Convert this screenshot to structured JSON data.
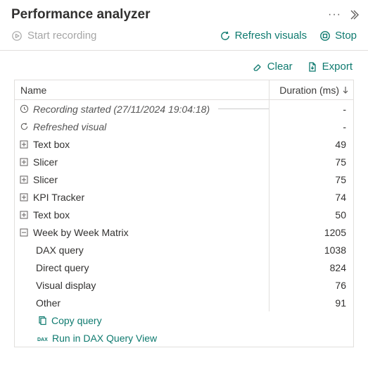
{
  "header": {
    "title": "Performance analyzer"
  },
  "toolbar": {
    "start_recording": "Start recording",
    "refresh_visuals": "Refresh visuals",
    "stop": "Stop"
  },
  "actions": {
    "clear": "Clear",
    "export": "Export"
  },
  "columns": {
    "name": "Name",
    "duration": "Duration (ms)"
  },
  "rows": {
    "recording_started": "Recording started (27/11/2024 19:04:18)",
    "refreshed_visual": "Refreshed visual",
    "dash": "-",
    "text_box_1": {
      "name": "Text box",
      "dur": "49"
    },
    "slicer_1": {
      "name": "Slicer",
      "dur": "75"
    },
    "slicer_2": {
      "name": "Slicer",
      "dur": "75"
    },
    "kpi": {
      "name": "KPI Tracker",
      "dur": "74"
    },
    "text_box_2": {
      "name": "Text box",
      "dur": "50"
    },
    "week_matrix": {
      "name": "Week by Week Matrix",
      "dur": "1205"
    },
    "dax": {
      "name": "DAX query",
      "dur": "1038"
    },
    "direct": {
      "name": "Direct query",
      "dur": "824"
    },
    "visdisp": {
      "name": "Visual display",
      "dur": "76"
    },
    "other": {
      "name": "Other",
      "dur": "91"
    }
  },
  "links": {
    "copy_query": "Copy query",
    "run_dax": "Run in DAX Query View"
  }
}
